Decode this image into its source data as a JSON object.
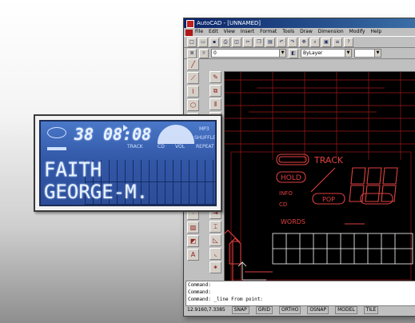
{
  "window": {
    "title": "AutoCAD - [UNNAMED]",
    "menus": [
      "File",
      "Edit",
      "View",
      "Insert",
      "Format",
      "Tools",
      "Draw",
      "Dimension",
      "Modify",
      "Help"
    ],
    "toolbar_icons": [
      "new-icon",
      "open-icon",
      "save-icon",
      "print-icon",
      "preview-icon",
      "cut-icon",
      "copy-icon",
      "paste-icon",
      "undo-icon",
      "redo-icon",
      "pan-icon",
      "zoom-icon",
      "zoom-window-icon",
      "properties-icon",
      "help-icon"
    ],
    "layer_combo": "0",
    "color_combo": "ByLayer"
  },
  "drawing": {
    "labels": {
      "track": "TRACK",
      "digits": "888",
      "hold": "HOLD",
      "info": "INFO",
      "cd": "CD",
      "pop": "POP",
      "words": "WORDS"
    }
  },
  "command": {
    "lines": [
      "Command:",
      "Command:",
      "Command:  _line From point:"
    ]
  },
  "status": {
    "coords": "12.9160,7.3385",
    "modes": [
      "SNAP",
      "GRID",
      "ORTHO",
      "OSNAP",
      "MODEL",
      "TILE"
    ]
  },
  "lcd": {
    "track": "38",
    "time": "08:08",
    "line1": "FAITH",
    "line2": "GEORGE-M.",
    "small_labels": [
      "TRACK",
      "CD",
      "MP3",
      "SHUFFLE",
      "REPEAT",
      "VOL"
    ]
  },
  "colors": {
    "lcd_background": "#3358a8",
    "lcd_text": "#e8f2ff",
    "drawing_background": "#000000",
    "drawing_lines": "#c02020",
    "titlebar": "#0a246a"
  }
}
